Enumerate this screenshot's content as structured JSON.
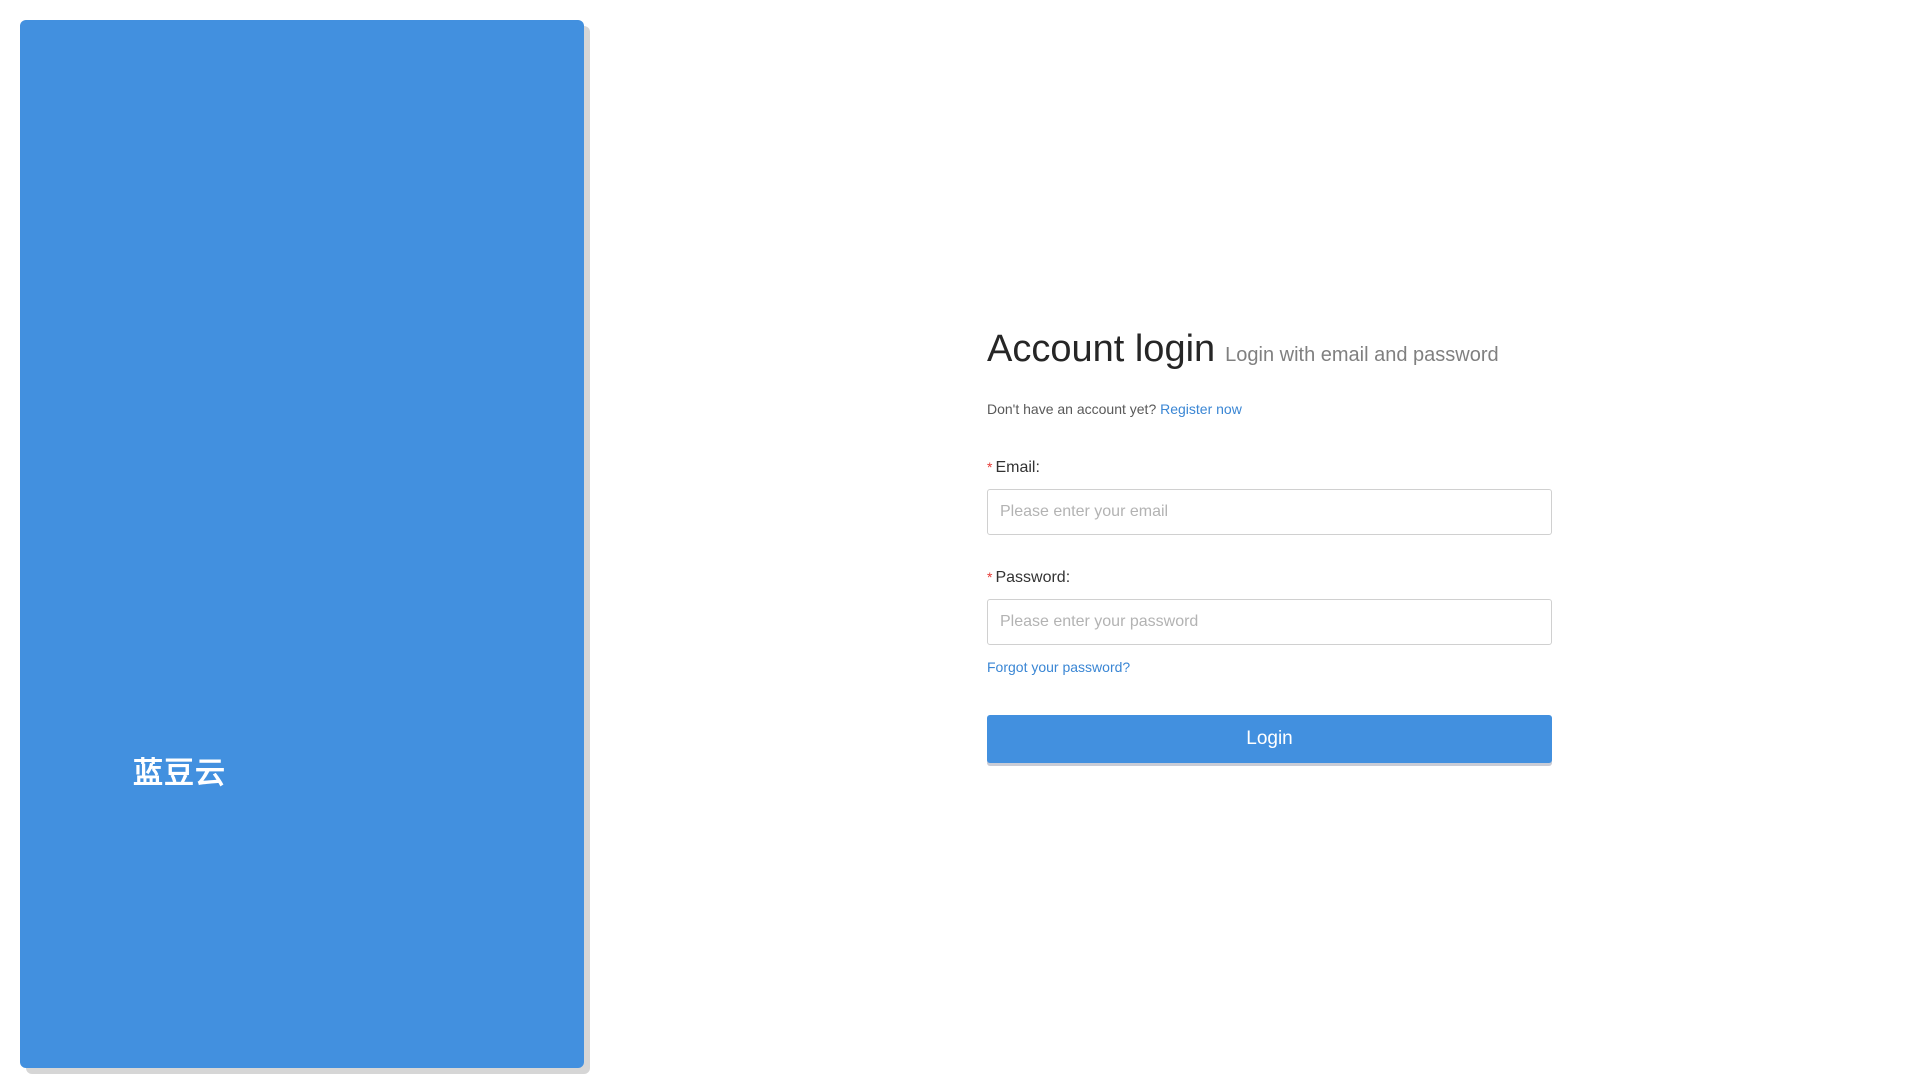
{
  "brand": {
    "name": "蓝豆云"
  },
  "login": {
    "title": "Account login",
    "subtitle": "Login with email and password",
    "register_prompt": "Don't have an account yet?",
    "register_link": "Register now",
    "email_label": "Email",
    "email_placeholder": "Please enter your email",
    "password_label": "Password",
    "password_placeholder": "Please enter your password",
    "required_mark": "*",
    "label_suffix": ":",
    "forgot_link": "Forgot your password?",
    "submit_label": "Login"
  },
  "colors": {
    "brand_blue": "#4290df",
    "link_blue": "#3a86d4",
    "required_red": "#e53935"
  }
}
